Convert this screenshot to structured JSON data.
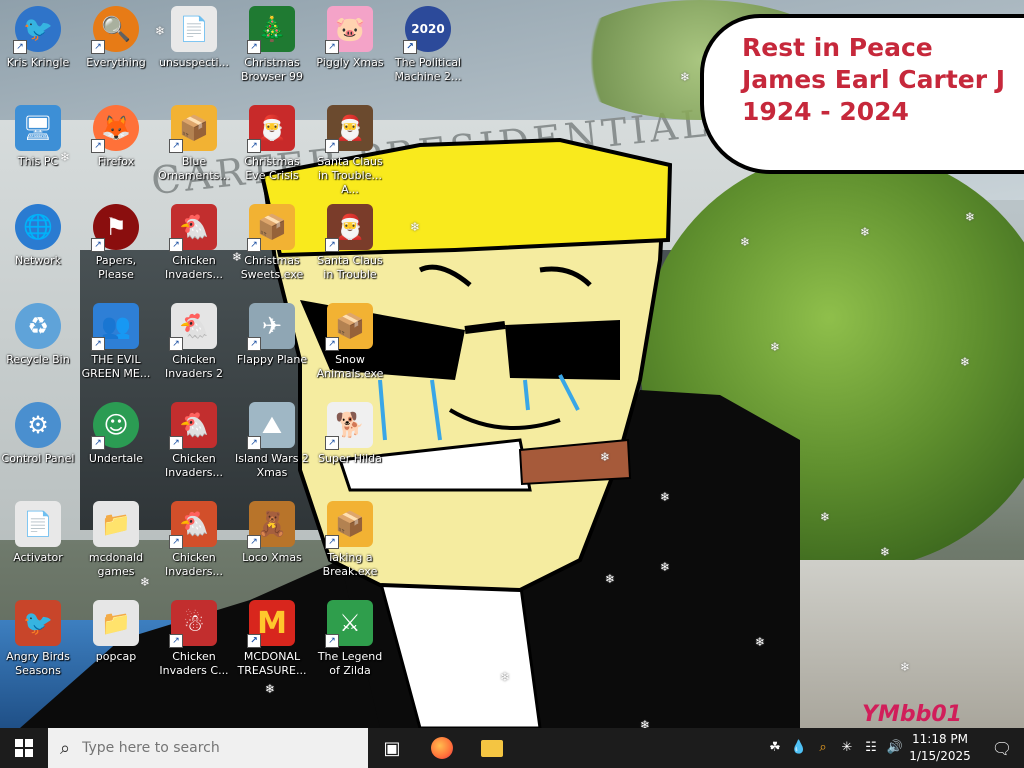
{
  "wallpaper": {
    "building_sign": "CARTER PRESIDENTIAL",
    "speech_bubble": [
      "Rest in Peace",
      "James Earl Carter J",
      "1924 - 2024"
    ],
    "signature": "YMbb01"
  },
  "desktop_icons": [
    {
      "label": "Kris Kringle",
      "icon": "bird-icon",
      "color": "#2f74c9"
    },
    {
      "label": "This PC",
      "icon": "computer-icon",
      "color": "#3d8fd6"
    },
    {
      "label": "Network",
      "icon": "globe-icon",
      "color": "#2a7bd1"
    },
    {
      "label": "Recycle Bin",
      "icon": "recycle-icon",
      "color": "#5fa3d9"
    },
    {
      "label": "Control Panel",
      "icon": "control-panel-icon",
      "color": "#4a8fcf"
    },
    {
      "label": "Activator",
      "icon": "folder-file-icon",
      "color": "#e8e8e8"
    },
    {
      "label": "Angry Birds Seasons",
      "icon": "angry-bird-icon",
      "color": "#c8452a"
    },
    {
      "label": "Everything",
      "icon": "magnifier-icon",
      "color": "#e77b16"
    },
    {
      "label": "Firefox",
      "icon": "firefox-icon",
      "color": "#ff7139"
    },
    {
      "label": "Papers, Please",
      "icon": "papers-please-icon",
      "color": "#8a0e0e"
    },
    {
      "label": "THE EVIL GREEN ME...",
      "icon": "people-icon",
      "color": "#2e7fd6"
    },
    {
      "label": "Undertale",
      "icon": "character-icon",
      "color": "#2b9c53"
    },
    {
      "label": "mcdonald games",
      "icon": "folder-icon",
      "color": "#e6e6e6"
    },
    {
      "label": "popcap",
      "icon": "folder-icon",
      "color": "#e6e6e6"
    },
    {
      "label": "unsuspecti...",
      "icon": "blank-file-icon",
      "color": "#e9e9e9"
    },
    {
      "label": "Blue Ornaments...",
      "icon": "installer-icon",
      "color": "#f2b233"
    },
    {
      "label": "Chicken Invaders...",
      "icon": "chicken-invaders-icon",
      "color": "#c22e2e"
    },
    {
      "label": "Chicken Invaders 2",
      "icon": "chicken-icon",
      "color": "#e5e5e5"
    },
    {
      "label": "Chicken Invaders...",
      "icon": "chicken-santa-icon",
      "color": "#c22e2e"
    },
    {
      "label": "Chicken Invaders...",
      "icon": "chicken-icon",
      "color": "#d24f2a"
    },
    {
      "label": "Chicken Invaders C...",
      "icon": "chicken-snowman-icon",
      "color": "#c22e2e"
    },
    {
      "label": "Christmas Browser 99",
      "icon": "christmas-tree-icon",
      "color": "#1f7a32"
    },
    {
      "label": "Christmas Eve Crisis",
      "icon": "santa-icon",
      "color": "#c82a2a"
    },
    {
      "label": "Christmas Sweets.exe",
      "icon": "installer-icon",
      "color": "#f2b233"
    },
    {
      "label": "Flappy Plane",
      "icon": "plane-icon",
      "color": "#8fa6b4"
    },
    {
      "label": "Island Wars 2 Xmas",
      "icon": "island-icon",
      "color": "#9fb7c5"
    },
    {
      "label": "Loco Xmas",
      "icon": "teddy-bear-icon",
      "color": "#b8742a"
    },
    {
      "label": "MCDONAL TREASURE...",
      "icon": "mcdonalds-icon",
      "color": "#d8261d"
    },
    {
      "label": "Piggly Xmas",
      "icon": "pig-icon",
      "color": "#f4a3c8"
    },
    {
      "label": "Santa Claus in Trouble... A...",
      "icon": "santa-icon",
      "color": "#6b4a2e"
    },
    {
      "label": "Santa Claus in Trouble",
      "icon": "santa-icon",
      "color": "#7a3c2a"
    },
    {
      "label": "Snow Animals.exe",
      "icon": "installer-icon",
      "color": "#f2b233"
    },
    {
      "label": "Super Hilda",
      "icon": "dog-icon",
      "color": "#f0f0f0"
    },
    {
      "label": "Taking a Break.exe",
      "icon": "installer-icon",
      "color": "#f2b233"
    },
    {
      "label": "The Legend of Zilda",
      "icon": "zelda-icon",
      "color": "#2f9e4c"
    },
    {
      "label": "The Political Machine 2...",
      "icon": "badge-2020-icon",
      "color": "#2c4a9a"
    }
  ],
  "taskbar": {
    "search_placeholder": "Type here to search",
    "pinned": [
      {
        "name": "task-view",
        "icon": "task-view-icon"
      },
      {
        "name": "firefox",
        "icon": "firefox-icon"
      },
      {
        "name": "file-explorer",
        "icon": "folder-icon"
      }
    ],
    "clock": {
      "time": "11:18 PM",
      "date": "1/15/2025"
    }
  }
}
